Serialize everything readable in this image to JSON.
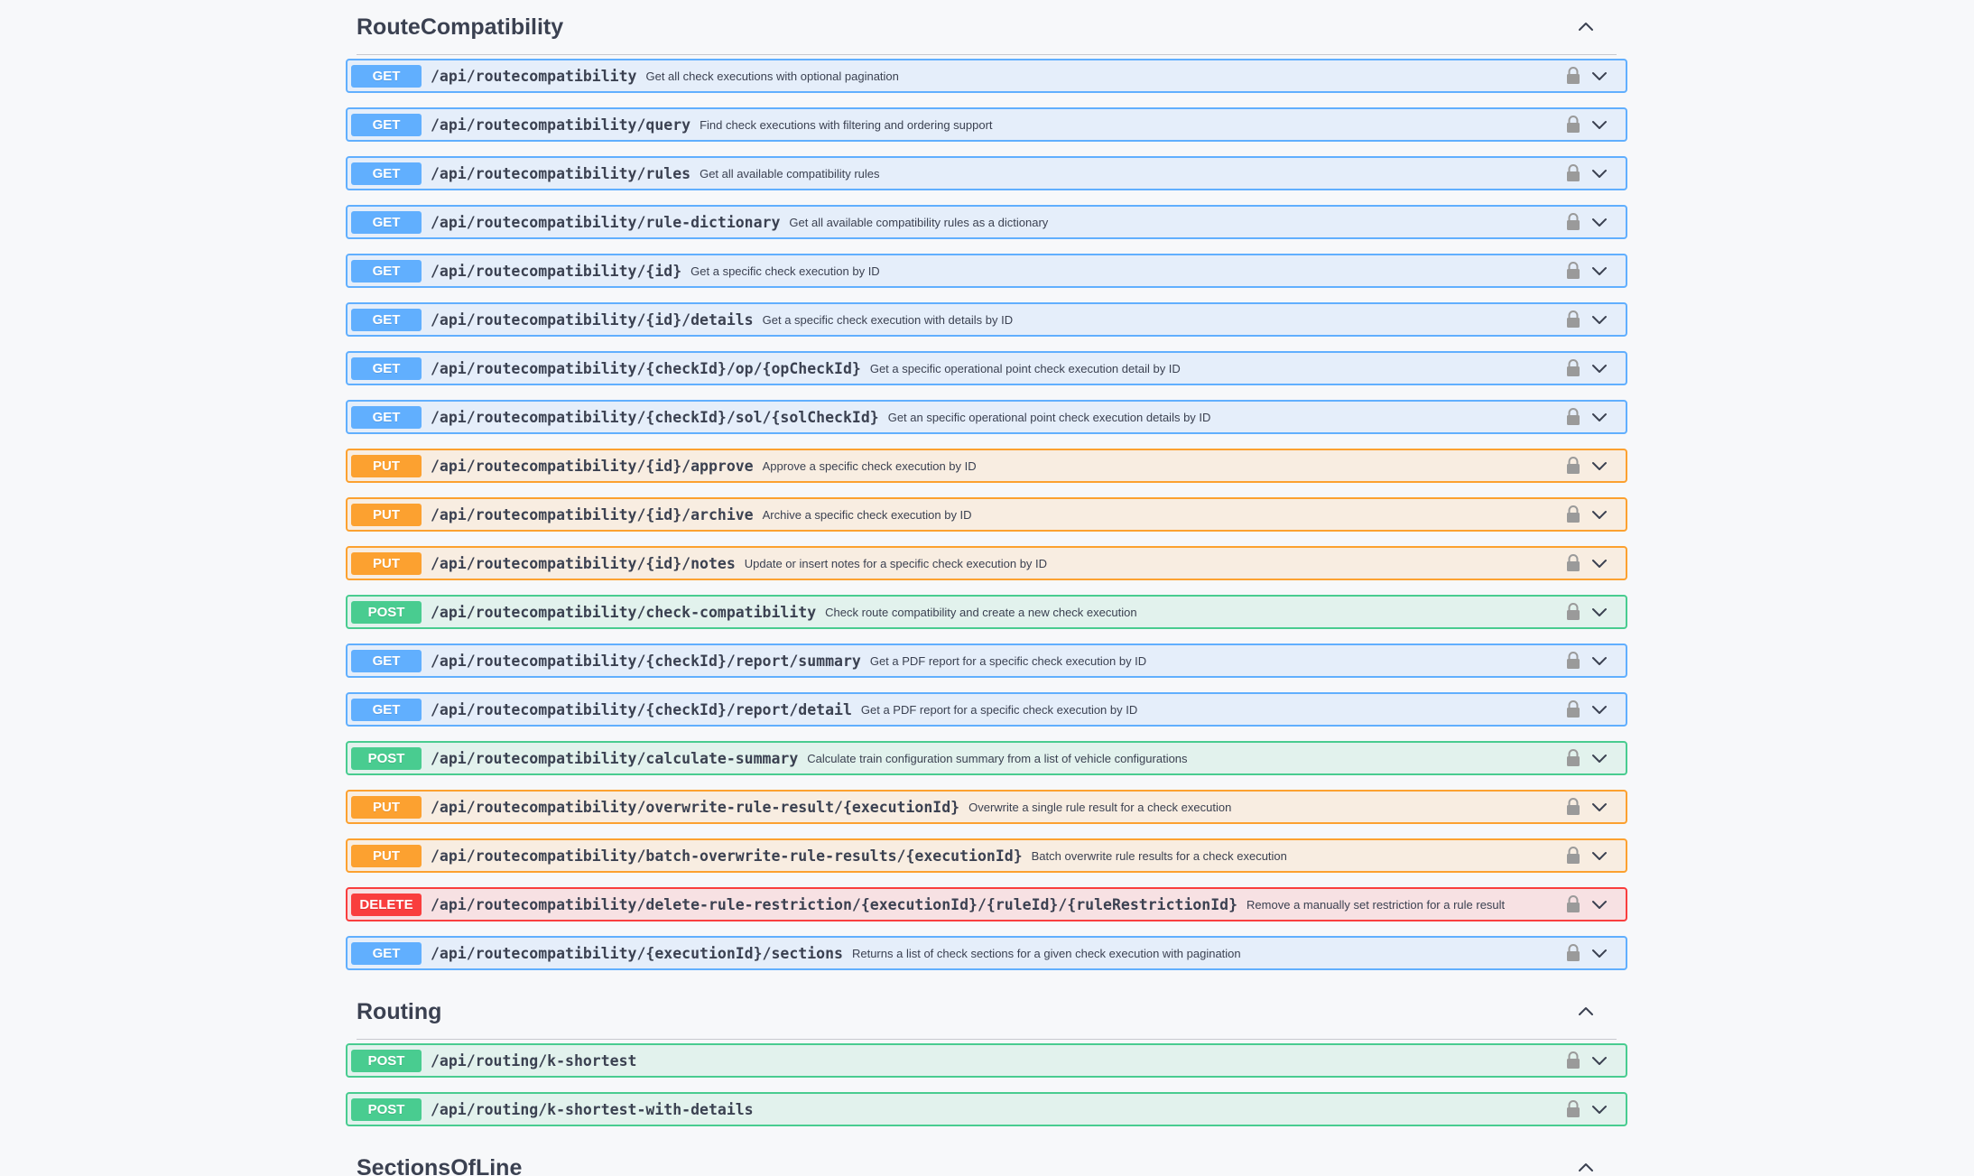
{
  "sections": [
    {
      "title": "RouteCompatibility",
      "operations": [
        {
          "method": "GET",
          "kind": "get",
          "path": "/api/routecompatibility",
          "summary": "Get all check executions with optional pagination"
        },
        {
          "method": "GET",
          "kind": "get",
          "path": "/api/routecompatibility/query",
          "summary": "Find check executions with filtering and ordering support"
        },
        {
          "method": "GET",
          "kind": "get",
          "path": "/api/routecompatibility/rules",
          "summary": "Get all available compatibility rules"
        },
        {
          "method": "GET",
          "kind": "get",
          "path": "/api/routecompatibility/rule-dictionary",
          "summary": "Get all available compatibility rules as a dictionary"
        },
        {
          "method": "GET",
          "kind": "get",
          "path": "/api/routecompatibility/{id}",
          "summary": "Get a specific check execution by ID"
        },
        {
          "method": "GET",
          "kind": "get",
          "path": "/api/routecompatibility/{id}/details",
          "summary": "Get a specific check execution with details by ID"
        },
        {
          "method": "GET",
          "kind": "get",
          "path": "/api/routecompatibility/{checkId}/op/{opCheckId}",
          "summary": "Get a specific operational point check execution detail by ID"
        },
        {
          "method": "GET",
          "kind": "get",
          "path": "/api/routecompatibility/{checkId}/sol/{solCheckId}",
          "summary": "Get an specific operational point check execution details by ID"
        },
        {
          "method": "PUT",
          "kind": "put",
          "path": "/api/routecompatibility/{id}/approve",
          "summary": "Approve a specific check execution by ID"
        },
        {
          "method": "PUT",
          "kind": "put",
          "path": "/api/routecompatibility/{id}/archive",
          "summary": "Archive a specific check execution by ID"
        },
        {
          "method": "PUT",
          "kind": "put",
          "path": "/api/routecompatibility/{id}/notes",
          "summary": "Update or insert notes for a specific check execution by ID"
        },
        {
          "method": "POST",
          "kind": "post",
          "path": "/api/routecompatibility/check-compatibility",
          "summary": "Check route compatibility and create a new check execution"
        },
        {
          "method": "GET",
          "kind": "get",
          "path": "/api/routecompatibility/{checkId}/report/summary",
          "summary": "Get a PDF report for a specific check execution by ID"
        },
        {
          "method": "GET",
          "kind": "get",
          "path": "/api/routecompatibility/{checkId}/report/detail",
          "summary": "Get a PDF report for a specific check execution by ID"
        },
        {
          "method": "POST",
          "kind": "post",
          "path": "/api/routecompatibility/calculate-summary",
          "summary": "Calculate train configuration summary from a list of vehicle configurations"
        },
        {
          "method": "PUT",
          "kind": "put",
          "path": "/api/routecompatibility/overwrite-rule-result/{executionId}",
          "summary": "Overwrite a single rule result for a check execution"
        },
        {
          "method": "PUT",
          "kind": "put",
          "path": "/api/routecompatibility/batch-overwrite-rule-results/{executionId}",
          "summary": "Batch overwrite rule results for a check execution"
        },
        {
          "method": "DELETE",
          "kind": "delete",
          "path": "/api/routecompatibility/delete-rule-restriction/{executionId}/{ruleId}/{ruleRestrictionId}",
          "summary": "Remove a manually set restriction for a rule result"
        },
        {
          "method": "GET",
          "kind": "get",
          "path": "/api/routecompatibility/{executionId}/sections",
          "summary": "Returns a list of check sections for a given check execution with pagination"
        }
      ]
    },
    {
      "title": "Routing",
      "operations": [
        {
          "method": "POST",
          "kind": "post",
          "path": "/api/routing/k-shortest",
          "summary": ""
        },
        {
          "method": "POST",
          "kind": "post",
          "path": "/api/routing/k-shortest-with-details",
          "summary": ""
        }
      ]
    },
    {
      "title": "SectionsOfLine",
      "operations": []
    }
  ],
  "icons": {
    "lock": "lock-icon",
    "expand": "chevron-down-icon",
    "collapse": "chevron-up-icon"
  },
  "colors": {
    "get": "#61affe",
    "put": "#fca130",
    "post": "#49cc90",
    "delete": "#f93e3e",
    "text": "#3b4151",
    "background": "#f7f8fa"
  }
}
